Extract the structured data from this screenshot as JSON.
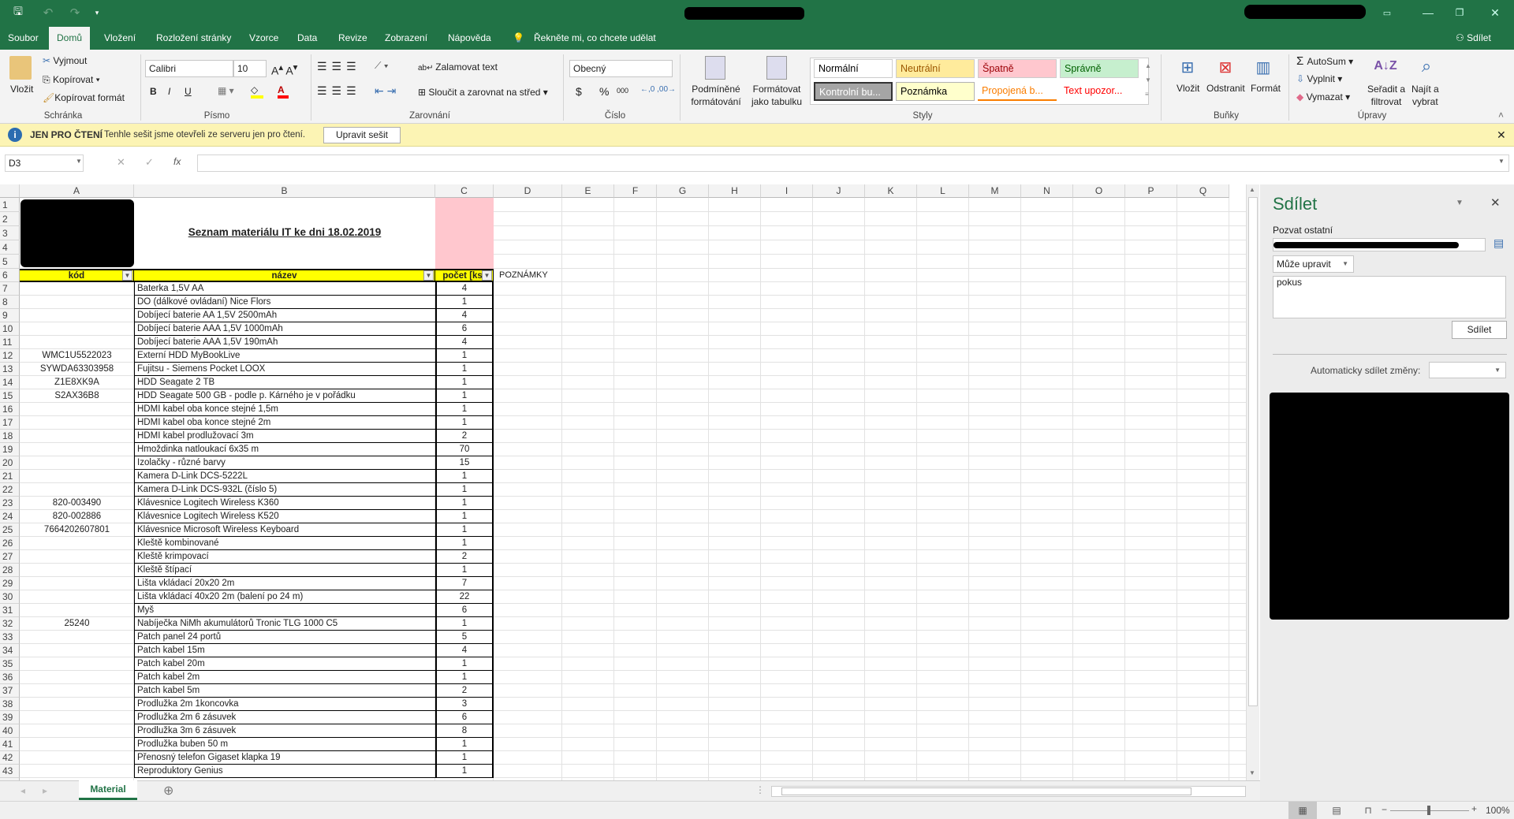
{
  "quick_access": {
    "save_icon": "save-icon",
    "undo_icon": "undo-icon",
    "redo_icon": "redo-icon"
  },
  "menu_tabs": [
    "Soubor",
    "Domů",
    "Vložení",
    "Rozložení stránky",
    "Vzorce",
    "Data",
    "Revize",
    "Zobrazení",
    "Nápověda"
  ],
  "active_tab": "Domů",
  "tell_me": "Řekněte mi, co chcete udělat",
  "share_top": "Sdílet",
  "ribbon": {
    "clipboard": {
      "paste": "Vložit",
      "cut": "Vyjmout",
      "copy": "Kopírovat",
      "format_painter": "Kopírovat formát",
      "group": "Schránka"
    },
    "font": {
      "name": "Calibri",
      "size": "10",
      "bold": "B",
      "italic": "I",
      "underline": "U",
      "group": "Písmo",
      "highlight_color": "#ffff00",
      "font_color": "#ff0000"
    },
    "alignment": {
      "wrap": "Zalamovat text",
      "merge": "Sloučit a zarovnat na střed",
      "group": "Zarovnání"
    },
    "number": {
      "format": "Obecný",
      "currency": "$",
      "percent": "%",
      "thousands": "000",
      "group": "Číslo"
    },
    "styles": {
      "conditional": [
        "Podmíněné",
        "formátování"
      ],
      "as_table": [
        "Formátovat",
        "jako tabulku"
      ],
      "group": "Styly",
      "cells": [
        {
          "label": "Normální",
          "bg": "#ffffff",
          "fg": "#000000"
        },
        {
          "label": "Neutrální",
          "bg": "#ffeb9c",
          "fg": "#9c5700"
        },
        {
          "label": "Špatně",
          "bg": "#ffc7ce",
          "fg": "#9c0006"
        },
        {
          "label": "Správně",
          "bg": "#c6efce",
          "fg": "#006100"
        },
        {
          "label": "Kontrolní bu...",
          "bg": "#a5a5a5",
          "fg": "#ffffff"
        },
        {
          "label": "Poznámka",
          "bg": "#ffffcc",
          "fg": "#000000"
        },
        {
          "label": "Propojená b...",
          "bg": "#ffffff",
          "fg": "#fa7d00"
        },
        {
          "label": "Text upozor...",
          "bg": "#ffffff",
          "fg": "#ff0000"
        }
      ]
    },
    "cells": {
      "insert": "Vložit",
      "delete": "Odstranit",
      "format": "Formát",
      "group": "Buňky"
    },
    "editing": {
      "autosum": "AutoSum",
      "fill": "Vyplnit",
      "clear": "Vymazat",
      "sort": [
        "Seřadit a",
        "filtrovat"
      ],
      "find": [
        "Najít a",
        "vybrat"
      ],
      "group": "Úpravy"
    }
  },
  "infobar": {
    "badge": "JEN PRO ČTENÍ",
    "message": "Tenhle sešit jsme otevřeli ze serveru jen pro čtení.",
    "button": "Upravit sešit"
  },
  "formula_bar": {
    "name_box": "D3",
    "fx": "fx",
    "value": ""
  },
  "columns": [
    "A",
    "B",
    "C",
    "D",
    "E",
    "F",
    "G",
    "H",
    "I",
    "J",
    "K",
    "L",
    "M",
    "N",
    "O",
    "P",
    "Q"
  ],
  "sheet": {
    "title": "Seznam materiálu IT ke dni 18.02.2019",
    "headers": [
      "kód",
      "název",
      "počet [ks]"
    ],
    "notes_label": "POZNÁMKY",
    "rows": [
      [
        "",
        "Baterka 1,5V AA",
        "4"
      ],
      [
        "",
        "DO (dálkové ovládaní) Nice Flors",
        "1"
      ],
      [
        "",
        "Dobíjecí baterie AA 1,5V 2500mAh",
        "4"
      ],
      [
        "",
        "Dobíjecí baterie AAA 1,5V 1000mAh",
        "6"
      ],
      [
        "",
        "Dobíjecí baterie AAA 1,5V 190mAh",
        "4"
      ],
      [
        "WMC1U5522023",
        "Externí HDD MyBookLive",
        "1"
      ],
      [
        "SYWDA63303958",
        "Fujitsu - Siemens Pocket LOOX",
        "1"
      ],
      [
        "Z1E8XK9A",
        "HDD Seagate 2 TB",
        "1"
      ],
      [
        "S2AX36B8",
        "HDD Seagate 500 GB - podle p. Kárného je v pořádku",
        "1"
      ],
      [
        "",
        "HDMI kabel oba konce stejné 1,5m",
        "1"
      ],
      [
        "",
        "HDMI kabel oba konce stejné 2m",
        "1"
      ],
      [
        "",
        "HDMI kabel prodlužovací 3m",
        "2"
      ],
      [
        "",
        "Hmoždinka natloukací 6x35 m",
        "70"
      ],
      [
        "",
        "Izolačky - různé barvy",
        "15"
      ],
      [
        "",
        "Kamera D-Link DCS-5222L",
        "1"
      ],
      [
        "",
        "Kamera D-Link DCS-932L (číslo 5)",
        "1"
      ],
      [
        "820-003490",
        "Klávesnice Logitech Wireless K360",
        "1"
      ],
      [
        "820-002886",
        "Klávesnice Logitech Wireless K520",
        "1"
      ],
      [
        "7664202607801",
        "Klávesnice Microsoft Wireless Keyboard",
        "1"
      ],
      [
        "",
        "Kleště kombinované",
        "1"
      ],
      [
        "",
        "Kleště krimpovací",
        "2"
      ],
      [
        "",
        "Kleště štípací",
        "1"
      ],
      [
        "",
        "Lišta vkládací 20x20 2m",
        "7"
      ],
      [
        "",
        "Lišta vkládací 40x20 2m (balení po 24 m)",
        "22"
      ],
      [
        "",
        "Myš",
        "6"
      ],
      [
        "25240",
        "Nabíječka NiMh akumulátorů Tronic TLG 1000 C5",
        "1"
      ],
      [
        "",
        "Patch panel 24 portů",
        "5"
      ],
      [
        "",
        "Patch kabel 15m",
        "4"
      ],
      [
        "",
        "Patch kabel 20m",
        "1"
      ],
      [
        "",
        "Patch kabel 2m",
        "1"
      ],
      [
        "",
        "Patch kabel 5m",
        "2"
      ],
      [
        "",
        "Prodlužka 2m 1koncovka",
        "3"
      ],
      [
        "",
        "Prodlužka 2m 6 zásuvek",
        "6"
      ],
      [
        "",
        "Prodlužka 3m 6 zásuvek",
        "8"
      ],
      [
        "",
        "Prodlužka buben 50 m",
        "1"
      ],
      [
        "",
        "Přenosný telefon Gigaset klapka 19",
        "1"
      ],
      [
        "",
        "Reproduktory Genius",
        "1"
      ]
    ]
  },
  "share_pane": {
    "title": "Sdílet",
    "invite_label": "Pozvat ostatní",
    "permission": "Může upravit",
    "message": "pokus",
    "share_button": "Sdílet",
    "auto_share_label": "Automaticky sdílet změny:"
  },
  "sheet_tabs": [
    "Material"
  ],
  "status": {
    "zoom": "100%"
  }
}
